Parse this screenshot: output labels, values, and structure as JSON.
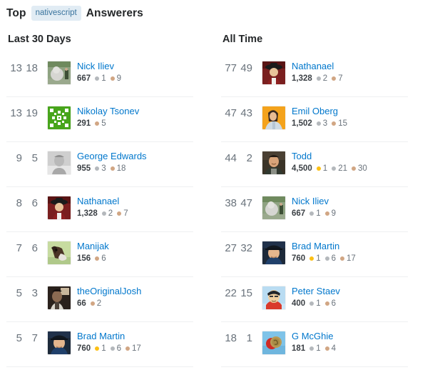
{
  "header": {
    "prefix": "Top",
    "tag": "nativescript",
    "suffix": "Answerers"
  },
  "colors": {
    "link": "#0077cc",
    "tag_bg": "#e1ecf4",
    "tag_text": "#39739d",
    "gold": "#fcc015",
    "silver": "#b4b8bc",
    "bronze": "#d1a684",
    "muted": "#6a737c"
  },
  "columns": [
    {
      "title": "Last 30 Days",
      "rows": [
        {
          "score": "13",
          "second": "18",
          "username": "Nick Iliev",
          "reputation": "667",
          "avatar": "statue-photo",
          "badges": [
            {
              "type": "silver",
              "count": "1"
            },
            {
              "type": "bronze",
              "count": "9"
            }
          ]
        },
        {
          "score": "13",
          "second": "19",
          "username": "Nikolay Tsonev",
          "reputation": "291",
          "avatar": "green-identicon",
          "badges": [
            {
              "type": "bronze",
              "count": "5"
            }
          ]
        },
        {
          "score": "9",
          "second": "5",
          "username": "George Edwards",
          "reputation": "955",
          "avatar": "grayscale-portrait",
          "badges": [
            {
              "type": "silver",
              "count": "3"
            },
            {
              "type": "bronze",
              "count": "18"
            }
          ]
        },
        {
          "score": "8",
          "second": "6",
          "username": "Nathanael",
          "reputation": "1,328",
          "avatar": "man-in-hat-portrait",
          "badges": [
            {
              "type": "silver",
              "count": "2"
            },
            {
              "type": "bronze",
              "count": "7"
            }
          ]
        },
        {
          "score": "7",
          "second": "6",
          "username": "Manijak",
          "reputation": "156",
          "avatar": "dog-photo",
          "badges": [
            {
              "type": "bronze",
              "count": "6"
            }
          ]
        },
        {
          "score": "5",
          "second": "3",
          "username": "theOriginalJosh",
          "reputation": "66",
          "avatar": "dark-selfie",
          "badges": [
            {
              "type": "bronze",
              "count": "2"
            }
          ]
        },
        {
          "score": "5",
          "second": "7",
          "username": "Brad Martin",
          "reputation": "760",
          "avatar": "man-with-cap",
          "badges": [
            {
              "type": "gold",
              "count": "1"
            },
            {
              "type": "silver",
              "count": "6"
            },
            {
              "type": "bronze",
              "count": "17"
            }
          ]
        }
      ]
    },
    {
      "title": "All Time",
      "rows": [
        {
          "score": "77",
          "second": "49",
          "username": "Nathanael",
          "reputation": "1,328",
          "avatar": "man-in-hat-portrait",
          "badges": [
            {
              "type": "silver",
              "count": "2"
            },
            {
              "type": "bronze",
              "count": "7"
            }
          ]
        },
        {
          "score": "47",
          "second": "43",
          "username": "Emil Oberg",
          "reputation": "1,502",
          "avatar": "orange-background-portrait",
          "badges": [
            {
              "type": "silver",
              "count": "3"
            },
            {
              "type": "bronze",
              "count": "15"
            }
          ]
        },
        {
          "score": "44",
          "second": "2",
          "username": "Todd",
          "reputation": "4,500",
          "avatar": "smiling-man-photo",
          "badges": [
            {
              "type": "gold",
              "count": "1"
            },
            {
              "type": "silver",
              "count": "21"
            },
            {
              "type": "bronze",
              "count": "30"
            }
          ]
        },
        {
          "score": "38",
          "second": "47",
          "username": "Nick Iliev",
          "reputation": "667",
          "avatar": "statue-photo",
          "badges": [
            {
              "type": "silver",
              "count": "1"
            },
            {
              "type": "bronze",
              "count": "9"
            }
          ]
        },
        {
          "score": "27",
          "second": "32",
          "username": "Brad Martin",
          "reputation": "760",
          "avatar": "man-with-cap",
          "badges": [
            {
              "type": "gold",
              "count": "1"
            },
            {
              "type": "silver",
              "count": "6"
            },
            {
              "type": "bronze",
              "count": "17"
            }
          ]
        },
        {
          "score": "22",
          "second": "15",
          "username": "Peter Staev",
          "reputation": "400",
          "avatar": "cartoon-avatar",
          "badges": [
            {
              "type": "silver",
              "count": "1"
            },
            {
              "type": "bronze",
              "count": "6"
            }
          ]
        },
        {
          "score": "18",
          "second": "1",
          "username": "G McGhie",
          "reputation": "181",
          "avatar": "red-cap-object",
          "badges": [
            {
              "type": "silver",
              "count": "1"
            },
            {
              "type": "bronze",
              "count": "4"
            }
          ]
        }
      ]
    }
  ]
}
